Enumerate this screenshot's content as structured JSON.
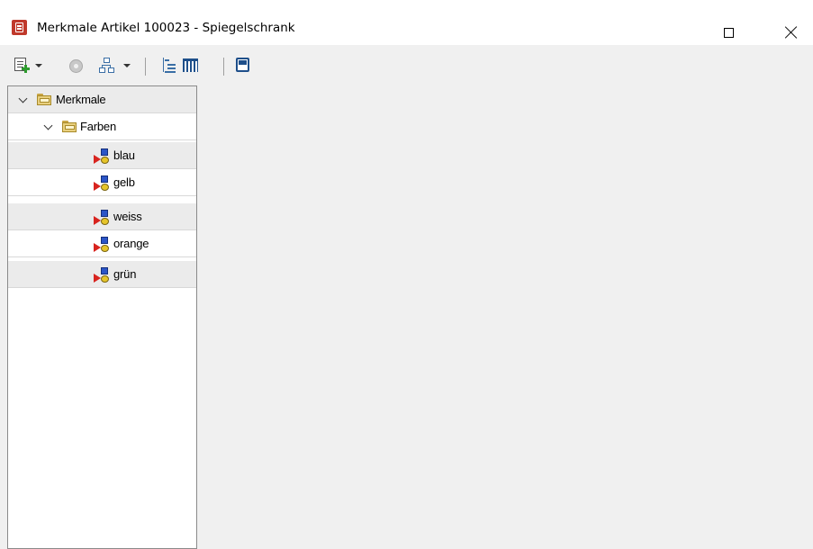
{
  "window": {
    "title": "Merkmale Artikel 100023 - Spiegelschrank"
  },
  "toolbar": {
    "items": [
      {
        "icon": "new-item-icon",
        "has_dropdown": true
      },
      {
        "icon": "disc-icon",
        "has_dropdown": false
      },
      {
        "icon": "hierarchy-icon",
        "has_dropdown": true
      },
      {
        "icon": "tree-view-icon",
        "has_dropdown": false
      },
      {
        "icon": "grid-view-icon",
        "has_dropdown": false
      },
      {
        "icon": "save-icon",
        "has_dropdown": false
      }
    ]
  },
  "tree": {
    "root": {
      "label": "Merkmale",
      "expanded": true
    },
    "group": {
      "label": "Farben",
      "expanded": true
    },
    "items": [
      {
        "label": "blau"
      },
      {
        "label": "gelb"
      },
      {
        "label": "weiss"
      },
      {
        "label": "orange"
      },
      {
        "label": "grün"
      }
    ]
  },
  "colors": {
    "title_bar": "#ffffff",
    "window_bg": "#f0f0f0",
    "tree_bg": "#ffffff",
    "tree_alt_row": "#ebebeb",
    "app_icon": "#c0392b"
  }
}
